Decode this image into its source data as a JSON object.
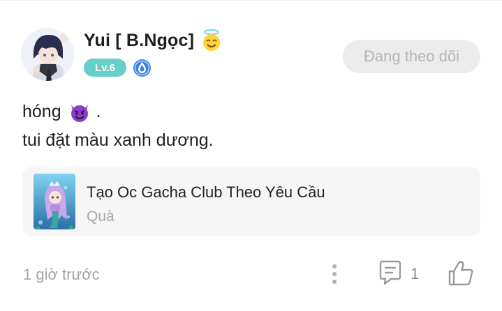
{
  "post": {
    "author": {
      "name": "Yui [ B.Ngọc]",
      "level": "Lv.6",
      "badge_icon": "angel-emoji",
      "level_color": "#66cfc8",
      "verified_icon": "blue-drop-badge"
    },
    "follow_label": "Đang theo dõi",
    "content": {
      "line1_text": "hóng",
      "line1_emoji": "smiling-devil-emoji",
      "line1_suffix": ".",
      "line2": "tui đặt màu xanh dương."
    },
    "attachment": {
      "title": "Tạo Oc Gacha Club Theo Yêu Cầu",
      "subtitle": "Quà"
    },
    "footer": {
      "timestamp": "1 giờ trước",
      "comment_count": "1",
      "icons": [
        "more-vertical-icon",
        "comment-icon",
        "like-icon"
      ]
    }
  },
  "colors": {
    "follow_bg": "#ececec",
    "follow_text": "#b6b6b6",
    "card_bg": "#f6f6f6",
    "muted_text": "#a3a3a3"
  }
}
